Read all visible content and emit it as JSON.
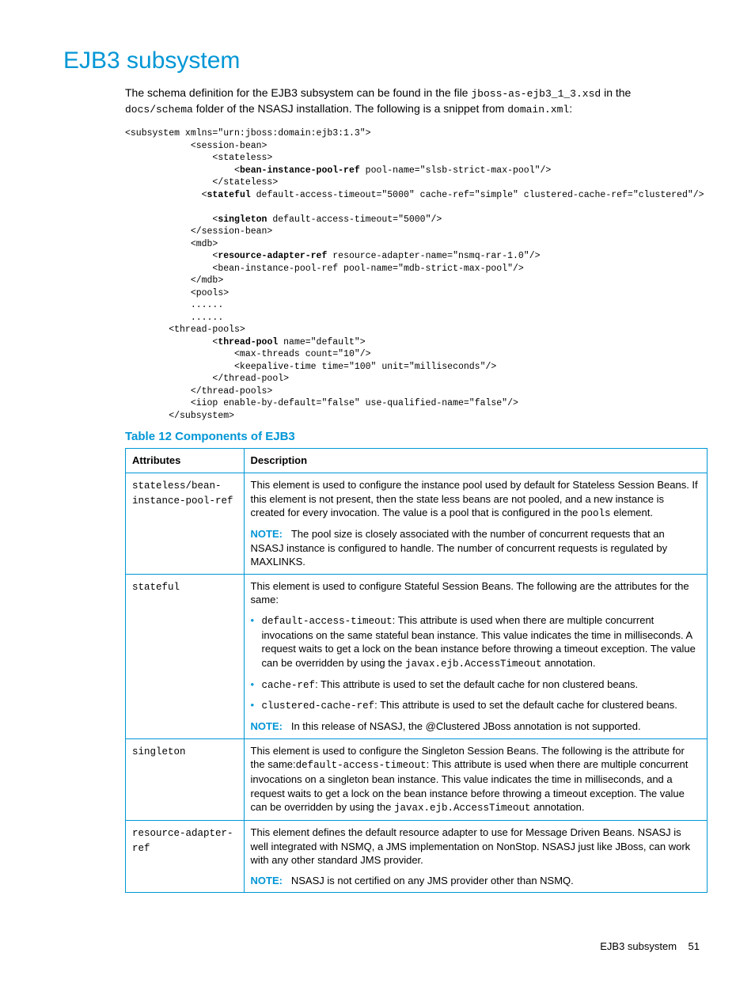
{
  "heading": "EJB3 subsystem",
  "intro_parts": {
    "t1": "The schema definition for the EJB3 subsystem can be found in the file ",
    "c1": "jboss-as-ejb3_1_3.xsd",
    "t2": " in the ",
    "c2": "docs/schema",
    "t3": " folder of the NSASJ installation. The following is a snippet from ",
    "c3": "domain.xml",
    "t4": ":"
  },
  "code": {
    "l1": "<subsystem xmlns=\"urn:jboss:domain:ejb3:1.3\">",
    "l2": "            <session-bean>",
    "l3": "                <stateless>",
    "l4a": "                    <",
    "l4b": "bean-instance-pool-ref",
    "l4c": " pool-name=\"slsb-strict-max-pool\"/>",
    "l5": "                </stateless>",
    "l6a": "              <",
    "l6b": "stateful",
    "l6c": " default-access-timeout=\"5000\" cache-ref=\"simple\" clustered-cache-ref=\"clustered\"/>",
    "l7": "",
    "l8a": "                <",
    "l8b": "singleton",
    "l8c": " default-access-timeout=\"5000\"/>",
    "l9": "            </session-bean>",
    "l10": "            <mdb>",
    "l11a": "                <",
    "l11b": "resource-adapter-ref",
    "l11c": " resource-adapter-name=\"nsmq-rar-1.0\"/>",
    "l12": "                <bean-instance-pool-ref pool-name=\"mdb-strict-max-pool\"/>",
    "l13": "            </mdb>",
    "l14": "            <pools>",
    "l15": "            ......",
    "l16": "            ......",
    "l17": "        <thread-pools>",
    "l18a": "                <",
    "l18b": "thread-pool",
    "l18c": " name=\"default\">",
    "l19": "                    <max-threads count=\"10\"/>",
    "l20": "                    <keepalive-time time=\"100\" unit=\"milliseconds\"/>",
    "l21": "                </thread-pool>",
    "l22": "            </thread-pools>",
    "l23": "            <iiop enable-by-default=\"false\" use-qualified-name=\"false\"/>",
    "l24": "        </subsystem>"
  },
  "table_title": "Table 12 Components of EJB3",
  "table": {
    "h1": "Attributes",
    "h2": "Description",
    "rows": [
      {
        "attr": "stateless/bean-instance-pool-ref",
        "p1a": "This element is used to configure the instance pool used by default for Stateless Session Beans. If this element is not present, then the state less beans are not pooled, and a new instance is created for every invocation. The value is a pool that is configured in the ",
        "p1code": "pools",
        "p1b": " element.",
        "noteLabel": "NOTE:",
        "noteText": "The pool size is closely associated with the number of concurrent requests that an NSASJ instance is configured to handle. The number of concurrent requests is regulated by MAXLINKS."
      },
      {
        "attr": "stateful",
        "p1": "This element is used to configure Stateful Session Beans. The following are the attributes for the same:",
        "bullets": [
          {
            "code": "default-access-timeout",
            "t1": ": This attribute is used when there are multiple concurrent invocations on the same stateful bean instance. This value indicates the time in milliseconds. A request waits to get a lock on the bean instance before throwing a timeout exception. The value can be overridden by using the ",
            "code2": "javax.ejb.AccessTimeout",
            "t2": " annotation."
          },
          {
            "code": "cache-ref",
            "t1": ": This attribute is used to set the default cache for non clustered beans."
          },
          {
            "code": "clustered-cache-ref",
            "t1": ": This attribute is used to set the default cache for clustered beans."
          }
        ],
        "noteLabel": "NOTE:",
        "noteText": "In this release of NSASJ, the @Clustered JBoss annotation is not supported."
      },
      {
        "attr": "singleton",
        "p1a": "This element is used to configure the Singleton Session Beans. The following is the attribute for the same:",
        "p1code": "default-access-timeout",
        "p1b": ": This attribute is used when there are multiple concurrent invocations on a singleton bean instance. This value indicates the time in milliseconds, and a request waits to get a lock on the bean instance before throwing a timeout exception. The value can be overridden by using the ",
        "p1code2": "javax.ejb.AccessTimeout",
        "p1c": " annotation."
      },
      {
        "attr": "resource-adapter-ref",
        "p1": "This element defines the default resource adapter to use for Message Driven Beans. NSASJ is well integrated with NSMQ, a JMS implementation on NonStop. NSASJ just like JBoss, can work with any other standard JMS provider.",
        "noteLabel": "NOTE:",
        "noteText": "NSASJ is not certified on any JMS provider other than NSMQ."
      }
    ]
  },
  "footer": {
    "title": "EJB3 subsystem",
    "page": "51"
  }
}
